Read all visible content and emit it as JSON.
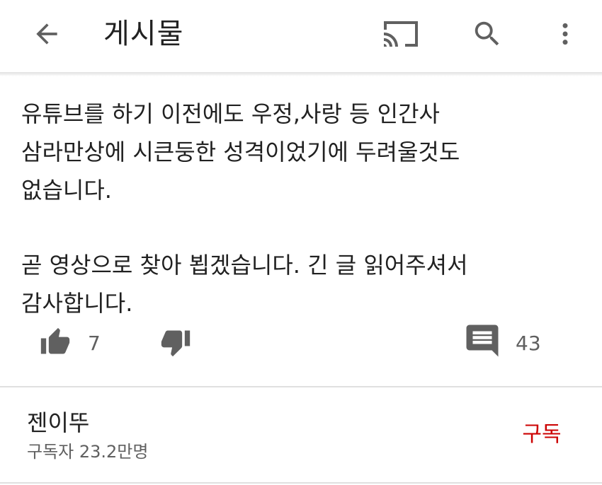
{
  "header": {
    "title": "게시물",
    "icons": [
      "back-arrow-icon",
      "cast-icon",
      "search-icon",
      "more-vert-icon"
    ]
  },
  "post": {
    "paragraph1": [
      "유튜브를 하기 이전에도 우정,사랑 등 인간사",
      "삼라만상에 시큰둥한 성격이었기에 두려울것도",
      "없습니다."
    ],
    "paragraph2": [
      "곧 영상으로 찾아 뵙겠습니다. 긴 글 읽어주셔서",
      "감사합니다."
    ]
  },
  "actions": {
    "like_count": "7",
    "comment_count": "43",
    "icons": [
      "thumb-up-icon",
      "thumb-down-icon",
      "comment-icon"
    ]
  },
  "channel": {
    "name": "젠이뚜",
    "subscribers": "구독자 23.2만명",
    "subscribe_label": "구독",
    "subscribe_color": "#cc0000"
  },
  "colors": {
    "icon": "#606060",
    "text": "#212121",
    "secondary_text": "#606060",
    "accent": "#cc0000"
  }
}
